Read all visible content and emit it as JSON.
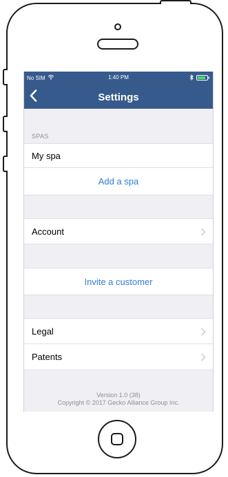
{
  "status_bar": {
    "carrier": "No SIM",
    "time": "1:40 PM",
    "wifi_icon": "wifi-icon",
    "bluetooth_icon": "bluetooth-icon",
    "battery_icon": "battery-icon"
  },
  "navbar": {
    "back_icon": "chevron-left-icon",
    "title": "Settings",
    "background_color": "#375a8c"
  },
  "spas_section": {
    "header": "SPAS",
    "spa_name": "My spa",
    "add_spa_label": "Add a spa"
  },
  "account_section": {
    "account_label": "Account"
  },
  "invite_section": {
    "invite_label": "Invite a customer"
  },
  "legal_section": {
    "legal_label": "Legal",
    "patents_label": "Patents"
  },
  "footer": {
    "version": "Version 1.0 (38)",
    "copyright": "Copyright © 2017 Gecko Alliance Group Inc."
  },
  "colors": {
    "accent": "#2f7dd1",
    "grouped_background": "#efeff4",
    "secondary_text": "#8e8e93"
  }
}
